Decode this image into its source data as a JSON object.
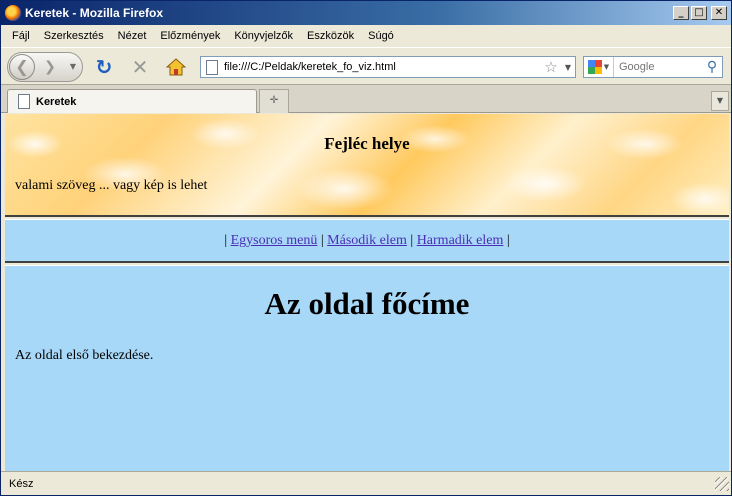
{
  "window": {
    "title": "Keretek - Mozilla Firefox",
    "minimize": "_",
    "maximize": "□",
    "close": "✕"
  },
  "menu": {
    "items": [
      "Fájl",
      "Szerkesztés",
      "Nézet",
      "Előzmények",
      "Könyvjelzők",
      "Eszközök",
      "Súgó"
    ]
  },
  "toolbar": {
    "back_icon": "back-arrow-icon",
    "forward_icon": "forward-arrow-icon",
    "reload_icon": "reload-icon",
    "stop_icon": "stop-icon",
    "home_icon": "home-icon",
    "url": "file:///C:/Peldak/keretek_fo_viz.html",
    "bookmark_icon": "star-icon",
    "search_engine": "Google",
    "search_placeholder": "Google"
  },
  "tabs": [
    {
      "label": "Keretek",
      "active": true
    }
  ],
  "page": {
    "header_frame": {
      "title": "Fejléc helye",
      "subtitle": "valami szöveg ... vagy kép is lehet"
    },
    "menu_frame": {
      "sep_open": "|",
      "links": [
        "Egysoros menü",
        "Második elem",
        "Harmadik elem"
      ],
      "sep": "|"
    },
    "main_frame": {
      "title": "Az oldal főcíme",
      "paragraph": "Az oldal első bekezdése."
    },
    "colors": {
      "background": "#a8d8f8",
      "link": "#4a2fb5"
    }
  },
  "status": {
    "text": "Kész"
  }
}
